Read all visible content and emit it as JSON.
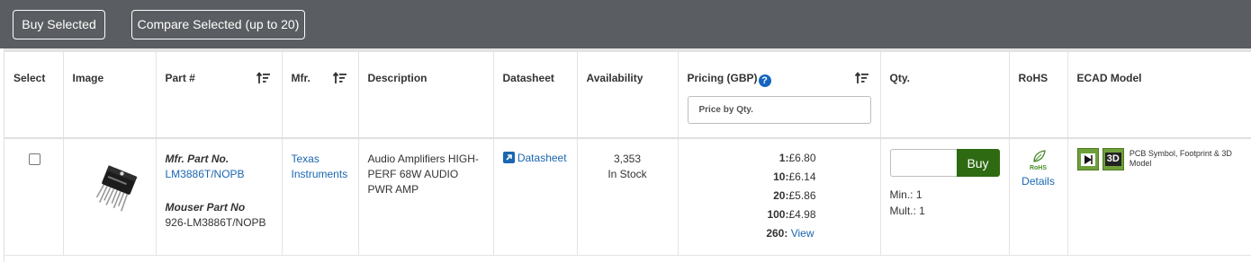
{
  "toolbar": {
    "buy_selected": "Buy Selected",
    "compare_selected": "Compare Selected (up to 20)"
  },
  "columns": {
    "select": "Select",
    "image": "Image",
    "part": "Part #",
    "mfr": "Mfr.",
    "description": "Description",
    "datasheet": "Datasheet",
    "availability": "Availability",
    "pricing": "Pricing (GBP)",
    "qty": "Qty.",
    "rohs": "RoHS",
    "ecad": "ECAD Model"
  },
  "pricing_filter": {
    "placeholder": "Price by Qty."
  },
  "row": {
    "mfr_part_label": "Mfr. Part No.",
    "mfr_part_no": "LM3886T/NOPB",
    "mouser_part_label": "Mouser Part No",
    "mouser_part_no": "926-LM3886T/NOPB",
    "mfr_line1": "Texas",
    "mfr_line2": "Instruments",
    "description": "Audio Amplifiers HIGH-PERF 68W AUDIO PWR AMP",
    "datasheet_label": "Datasheet",
    "stock_qty": "3,353",
    "stock_status": "In Stock",
    "prices": [
      {
        "qty": "1:",
        "price": "£6.80"
      },
      {
        "qty": "10:",
        "price": "£6.14"
      },
      {
        "qty": "20:",
        "price": "£5.86"
      },
      {
        "qty": "100:",
        "price": "£4.98"
      }
    ],
    "price_more_qty": "260:",
    "price_more_link": "View",
    "buy_label": "Buy",
    "min_qty": "Min.: 1",
    "mult_qty": "Mult.: 1",
    "rohs_badge": "RoHS",
    "rohs_details": "Details",
    "ecad_3d_badge": "3D",
    "ecad_text": "PCB Symbol, Footprint & 3D Model"
  },
  "colors": {
    "toolbar_bg": "#5a5d61",
    "link": "#1a66b0",
    "buy_button": "#2e6a12",
    "ecad_green": "#6da03a"
  }
}
